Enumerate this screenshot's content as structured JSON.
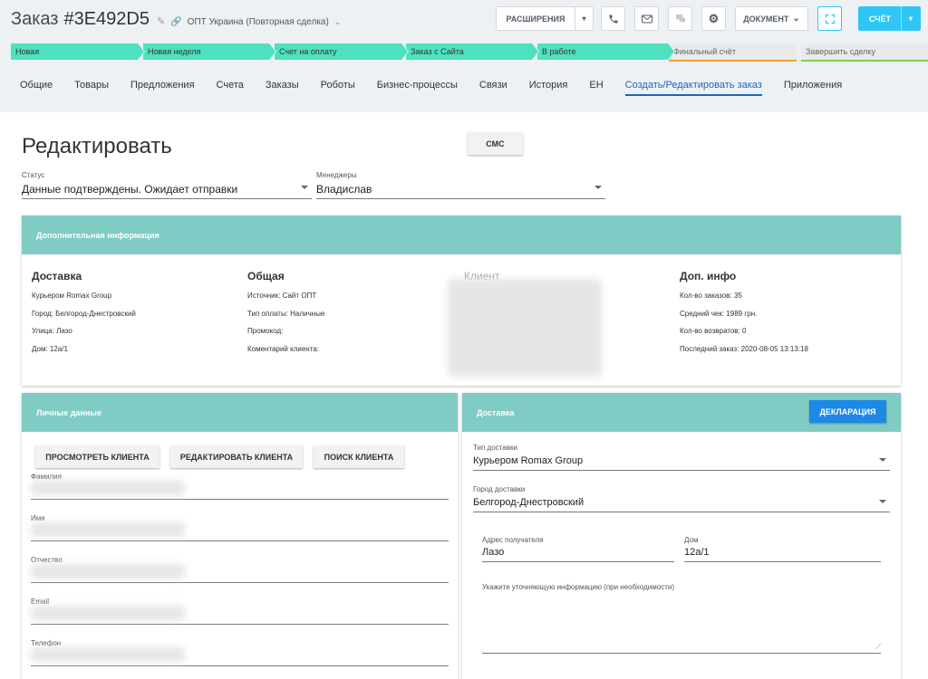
{
  "header": {
    "deal_label": "Заказ",
    "deal_number": "#3E492D5",
    "subtitle": "ОПТ Украина (Повторная сделка)",
    "extensions_label": "РАСШИРЕНИЯ",
    "document_label": "ДОКУМЕНТ",
    "invoice_label": "СЧЁТ"
  },
  "stages": [
    {
      "label": "Новая",
      "state": "done"
    },
    {
      "label": "Новая неделя",
      "state": "done"
    },
    {
      "label": "Счет на оплату",
      "state": "done"
    },
    {
      "label": "Заказ с Сайта",
      "state": "done"
    },
    {
      "label": "В работе",
      "state": "done"
    },
    {
      "label": "Финальный счёт",
      "state": "todo",
      "underline": "#f0a030"
    },
    {
      "label": "Завершить сделку",
      "state": "todo",
      "underline": "#7bd148"
    }
  ],
  "tabs": [
    {
      "label": "Общие"
    },
    {
      "label": "Товары"
    },
    {
      "label": "Предложения"
    },
    {
      "label": "Счета"
    },
    {
      "label": "Заказы"
    },
    {
      "label": "Роботы"
    },
    {
      "label": "Бизнес-процессы"
    },
    {
      "label": "Связи"
    },
    {
      "label": "История"
    },
    {
      "label": "ЕН"
    },
    {
      "label": "Создать/Редактировать заказ",
      "active": true
    },
    {
      "label": "Приложения"
    }
  ],
  "page": {
    "title": "Редактировать",
    "sms_label": "СМС",
    "status": {
      "label": "Статус",
      "value": "Данные подтверждены. Ожидает отправки"
    },
    "managers": {
      "label": "Менеджеры",
      "value": "Владислав"
    }
  },
  "additional": {
    "title": "Дополнительная информация",
    "delivery": {
      "heading": "Доставка",
      "rows": [
        "Курьером Romax Group",
        "Город: Белгород-Днестровский",
        "Улица: Лазо",
        "Дом: 12а/1"
      ]
    },
    "general": {
      "heading": "Общая",
      "rows": [
        "Источник: Сайт ОПТ",
        "Тип оплаты: Наличные",
        "Промокод:",
        "Коментарий клиента:"
      ]
    },
    "client": {
      "heading": "Клиент"
    },
    "extra": {
      "heading": "Доп. инфо",
      "rows": [
        "Кол-во заказов: 35",
        "Средний чек: 1989 грн.",
        "Кол-во возвратов: 0",
        "Последний заказ: 2020-08-05 13:13:18"
      ]
    }
  },
  "personal": {
    "title": "Личные данные",
    "view_client": "ПРОСМОТРЕТЬ КЛИЕНТА",
    "edit_client": "РЕДАКТИРОВАТЬ КЛИЕНТА",
    "search_client": "ПОИСК КЛИЕНТА",
    "fields": [
      "Фамилия",
      "Имя",
      "Отчество",
      "Email",
      "Телефон"
    ]
  },
  "shipping": {
    "title": "Доставка",
    "declaration_label": "ДЕКЛАРАЦИЯ",
    "type": {
      "label": "Тип доставки",
      "value": "Курьером Romax Group"
    },
    "city": {
      "label": "Город доставки",
      "value": "Белгород-Днестровский"
    },
    "address": {
      "label": "Адрес получателя",
      "value": "Лазо"
    },
    "house": {
      "label": "Дом",
      "value": "12а/1"
    },
    "notes": {
      "label": "Укажите уточняющую информацию (при необходимости)"
    }
  },
  "colors": {
    "stage_done": "#4ee1c0",
    "card_header": "#80cbc4",
    "accent_blue": "#1e88e5",
    "active_tab": "#2067b0"
  }
}
